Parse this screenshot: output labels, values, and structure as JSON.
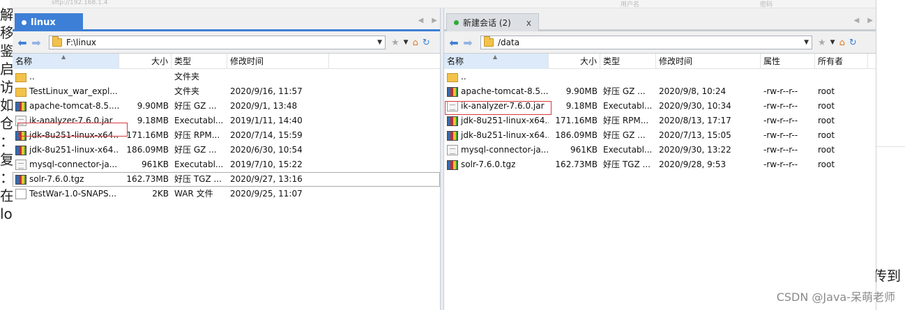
{
  "background": {
    "left_chars": [
      "解",
      "移",
      "鉴",
      "启",
      "访",
      "如",
      "仓",
      "：",
      "复",
      "：",
      "在",
      "lo"
    ],
    "right_text": "传到",
    "watermark": "CSDN @Java-呆萌老师",
    "top_strip": {
      "address": "sftp://192.168.1.4",
      "user_label": "用户名",
      "pass_label": "密码"
    }
  },
  "left": {
    "tab": {
      "label": "linux"
    },
    "address": "F:\\linux",
    "columns": [
      "名称",
      "大小",
      "类型",
      "修改时间"
    ],
    "files": [
      {
        "name": "..",
        "size": "",
        "type": "文件夹",
        "modified": "",
        "icon": "folder-icon"
      },
      {
        "name": "TestLinux_war_expl...",
        "size": "",
        "type": "文件夹",
        "modified": "2020/9/16, 11:57",
        "icon": "folder-icon"
      },
      {
        "name": "apache-tomcat-8.5....",
        "size": "9.90MB",
        "type": "好压 GZ ...",
        "modified": "2020/9/1, 13:48",
        "icon": "archive-icon"
      },
      {
        "name": "ik-analyzer-7.6.0.jar",
        "size": "9.18MB",
        "type": "Executabl...",
        "modified": "2019/1/11, 14:40",
        "icon": "jar-icon"
      },
      {
        "name": "jdk-8u251-linux-x64...",
        "size": "171.16MB",
        "type": "好压 RPM...",
        "modified": "2020/7/14, 15:59",
        "icon": "archive-icon"
      },
      {
        "name": "jdk-8u251-linux-x64...",
        "size": "186.09MB",
        "type": "好压 GZ ...",
        "modified": "2020/6/30, 10:54",
        "icon": "archive-icon"
      },
      {
        "name": "mysql-connector-ja...",
        "size": "961KB",
        "type": "Executabl...",
        "modified": "2019/7/10, 15:22",
        "icon": "jar-icon"
      },
      {
        "name": "solr-7.6.0.tgz",
        "size": "162.73MB",
        "type": "好压 TGZ ...",
        "modified": "2020/9/27, 13:16",
        "icon": "archive-icon"
      },
      {
        "name": "TestWar-1.0-SNAPS...",
        "size": "2KB",
        "type": "WAR 文件",
        "modified": "2020/9/25, 11:07",
        "icon": "file-icon"
      }
    ]
  },
  "right": {
    "tab": {
      "label": "新建会话 (2)",
      "close": "x"
    },
    "address": "/data",
    "columns": [
      "名称",
      "大小",
      "类型",
      "修改时间",
      "属性",
      "所有者"
    ],
    "files": [
      {
        "name": "..",
        "size": "",
        "type": "",
        "modified": "",
        "attr": "",
        "owner": "",
        "icon": "folder-icon"
      },
      {
        "name": "apache-tomcat-8.5....",
        "size": "9.90MB",
        "type": "好压 GZ ...",
        "modified": "2020/9/8, 10:24",
        "attr": "-rw-r--r--",
        "owner": "root",
        "icon": "archive-icon"
      },
      {
        "name": "ik-analyzer-7.6.0.jar",
        "size": "9.18MB",
        "type": "Executabl...",
        "modified": "2020/9/30, 10:34",
        "attr": "-rw-r--r--",
        "owner": "root",
        "icon": "jar-icon"
      },
      {
        "name": "jdk-8u251-linux-x64...",
        "size": "171.16MB",
        "type": "好压 RPM...",
        "modified": "2020/8/13, 17:17",
        "attr": "-rw-r--r--",
        "owner": "root",
        "icon": "archive-icon"
      },
      {
        "name": "jdk-8u251-linux-x64...",
        "size": "186.09MB",
        "type": "好压 GZ ...",
        "modified": "2020/7/13, 15:05",
        "attr": "-rw-r--r--",
        "owner": "root",
        "icon": "archive-icon"
      },
      {
        "name": "mysql-connector-ja...",
        "size": "961KB",
        "type": "Executabl...",
        "modified": "2020/9/30, 13:22",
        "attr": "-rw-r--r--",
        "owner": "root",
        "icon": "jar-icon"
      },
      {
        "name": "solr-7.6.0.tgz",
        "size": "162.73MB",
        "type": "好压 TGZ ...",
        "modified": "2020/9/28, 9:53",
        "attr": "-rw-r--r--",
        "owner": "root",
        "icon": "archive-icon"
      }
    ]
  },
  "colors": {
    "accent": "#3d7fd6",
    "highlight_box": "#d63a3a",
    "session_dot": "#2cae35"
  }
}
